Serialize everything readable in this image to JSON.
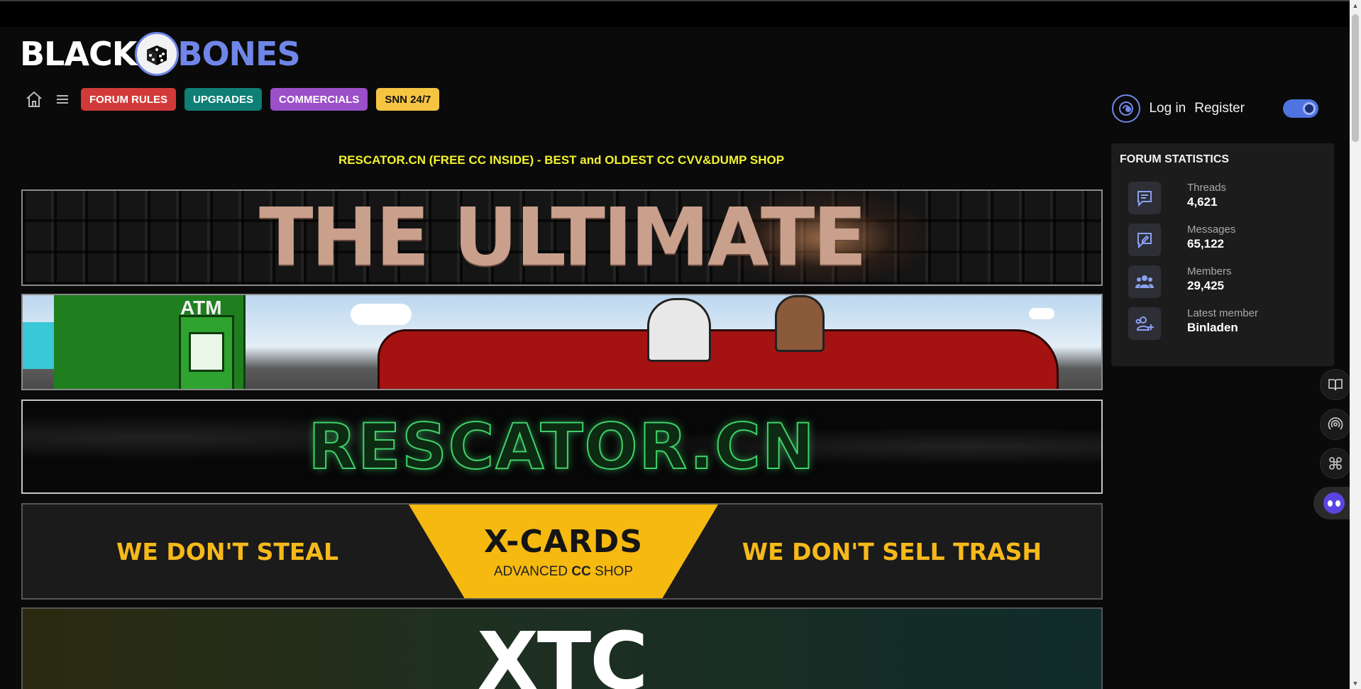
{
  "logo": {
    "left_text": "BLACK",
    "right_text": "BONES"
  },
  "nav": {
    "home_icon": "home-icon",
    "menu_icon": "hamburger-menu-icon",
    "pills": [
      {
        "label": "FORUM RULES",
        "color": "#d23a3a"
      },
      {
        "label": "UPGRADES",
        "color": "#0f7f76"
      },
      {
        "label": "COMMERCIALS",
        "color": "#9b4fc8"
      },
      {
        "label": "SNN 24/7",
        "color": "#f5c542"
      }
    ]
  },
  "auth": {
    "login": "Log in",
    "register": "Register",
    "theme_toggle_on": true
  },
  "headline": "RESCATOR.CN (FREE CC INSIDE) - BEST and OLDEST CC CVV&DUMP SHOP",
  "banners": {
    "ultimate": "THE ULTIMATE",
    "atm_label": "ATM",
    "rescator": "RESCATOR.CN",
    "xcards": {
      "left": "WE DON'T STEAL",
      "right": "WE DON'T SELL TRASH",
      "title": "X-CARDS",
      "sub_before": "ADVANCED",
      "sub_bold": "CC",
      "sub_after": "SHOP"
    },
    "xtc": "XTC"
  },
  "stats": {
    "title": "FORUM STATISTICS",
    "items": [
      {
        "label": "Threads",
        "value": "4,621",
        "icon": "chat-bubble-icon"
      },
      {
        "label": "Messages",
        "value": "65,122",
        "icon": "edit-message-icon"
      },
      {
        "label": "Members",
        "value": "29,425",
        "icon": "users-icon"
      },
      {
        "label": "Latest member",
        "value": "Binladen",
        "icon": "add-user-icon"
      }
    ]
  },
  "floating_buttons": [
    "book-icon",
    "broadcast-icon",
    "command-icon",
    "chat-bot-icon"
  ],
  "colors": {
    "accent": "#6f86e8",
    "headline": "#f2f230",
    "background": "#0a0a0a"
  }
}
